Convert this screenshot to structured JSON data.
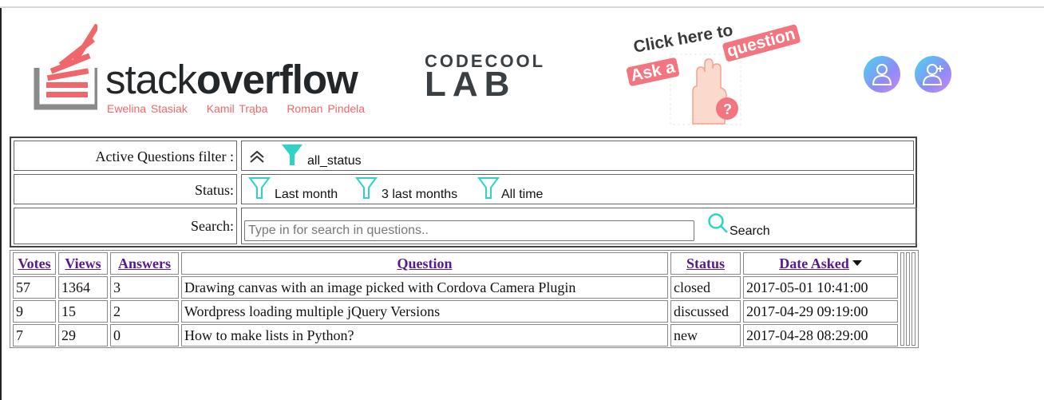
{
  "header": {
    "logo": {
      "word_light": "stack",
      "word_bold": "overflow",
      "authors": [
        "Ewelina Stasiak",
        "Kamil Trąba",
        "Roman Pindela"
      ]
    },
    "codecool": {
      "top": "CODECOOL",
      "bottom": "LAB"
    },
    "ask": {
      "line1": "Click here to",
      "line2": "Ask a",
      "line3": "question"
    },
    "icons": [
      "user-icon",
      "add-user-icon"
    ]
  },
  "filters": {
    "active_label": "Active Questions filter :",
    "active_value": "all_status",
    "status_label": "Status:",
    "status_options": [
      "Last month",
      "3 last months",
      "All time"
    ],
    "search_label": "Search:",
    "search_placeholder": "Type in for search in questions..",
    "search_value": "",
    "search_button": "Search",
    "accent_color": "#2ed3c6"
  },
  "table": {
    "headers": {
      "votes": "Votes",
      "views": "Views",
      "answers": "Answers",
      "question": "Question",
      "status": "Status",
      "date": "Date Asked"
    },
    "sort_column": "date",
    "sort_direction": "desc",
    "rows": [
      {
        "votes": "57",
        "views": "1364",
        "answers": "3",
        "question": "Drawing canvas with an image picked with Cordova Camera Plugin",
        "status": "closed",
        "date": "2017-05-01 10:41:00"
      },
      {
        "votes": "9",
        "views": "15",
        "answers": "2",
        "question": "Wordpress loading multiple jQuery Versions",
        "status": "discussed",
        "date": "2017-04-29 09:19:00"
      },
      {
        "votes": "7",
        "views": "29",
        "answers": "0",
        "question": "How to make lists in Python?",
        "status": "new",
        "date": "2017-04-28 08:29:00"
      }
    ]
  }
}
